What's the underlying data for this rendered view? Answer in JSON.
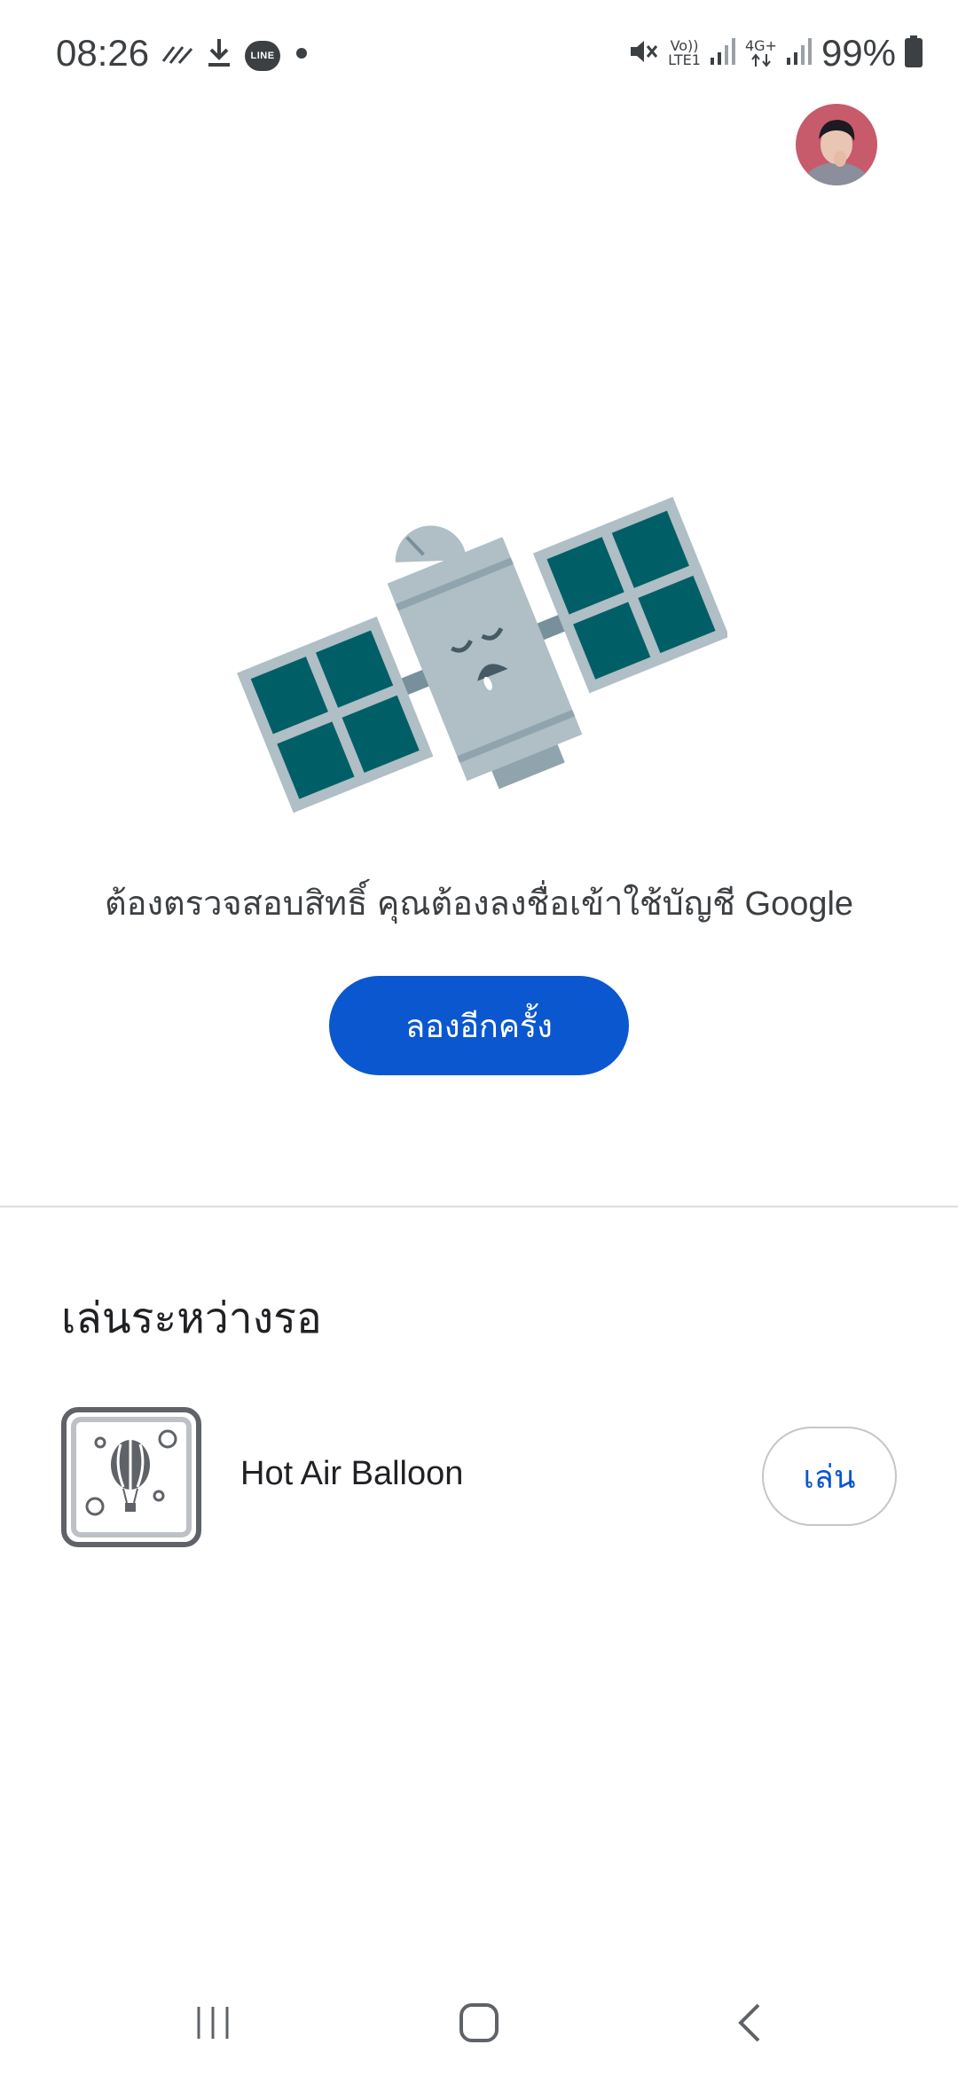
{
  "status_bar": {
    "time": "08:26",
    "battery": "99%",
    "line_label": "LINE",
    "volte_label_top": "Vo))",
    "volte_label_bottom": "LTE1",
    "network_label": "4G+",
    "left_icons": [
      "signal-wave-icon",
      "download-icon",
      "line-app-icon",
      "dot-icon"
    ],
    "right_icons": [
      "mute-icon",
      "volte-icon",
      "signal-icon",
      "4g-icon",
      "signal-icon",
      "battery-icon"
    ]
  },
  "error": {
    "message": "ต้องตรวจสอบสิทธิ์ คุณต้องลงชื่อเข้าใช้บัญชี Google",
    "retry_label": "ลองอีกครั้ง",
    "illustration": "sleeping-satellite-illustration"
  },
  "games": {
    "section_title": "เล่นระหว่างรอ",
    "items": [
      {
        "name": "Hot Air Balloon",
        "play_label": "เล่น",
        "icon": "hot-air-balloon-icon"
      }
    ]
  },
  "nav": {
    "items": [
      "recent-apps-icon",
      "home-icon",
      "back-icon"
    ]
  },
  "colors": {
    "accent": "#0b57d0",
    "panel": "#005f66",
    "satellite_body": "#b0bec5"
  }
}
